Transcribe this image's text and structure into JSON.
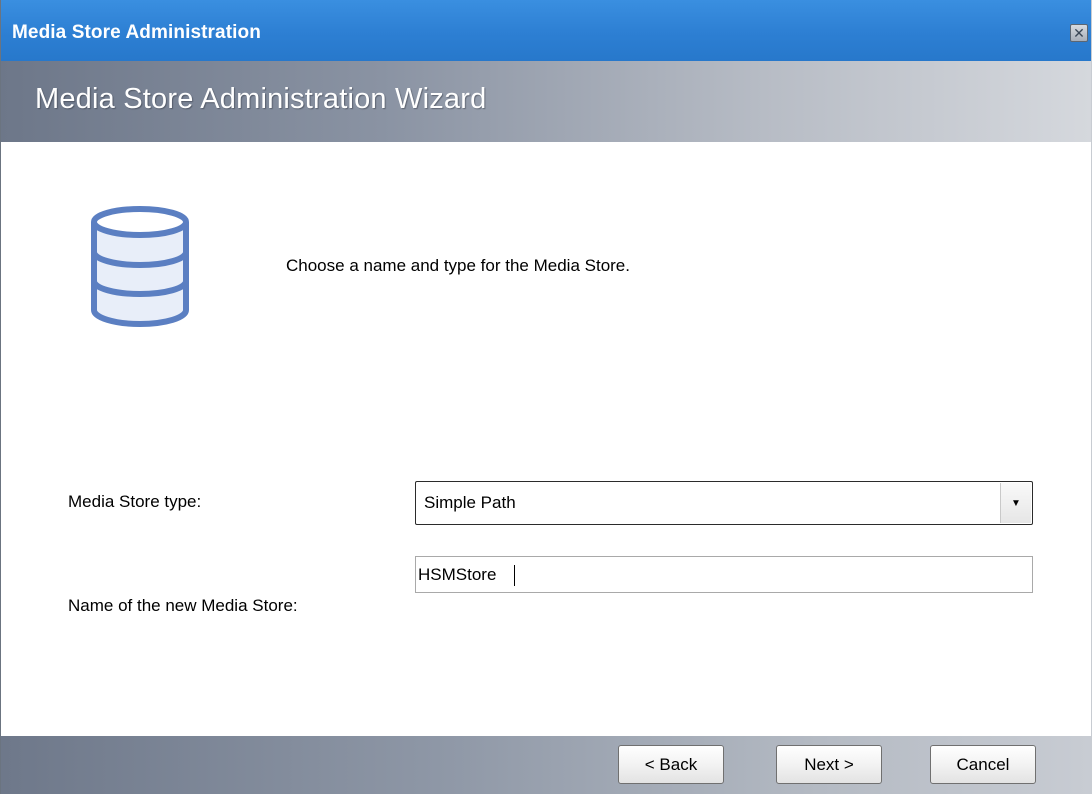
{
  "window": {
    "title": "Media Store Administration",
    "close_icon": "close-icon",
    "close_glyph": "✕"
  },
  "banner": {
    "title": "Media Store Administration Wizard"
  },
  "main": {
    "icon": "database-icon",
    "prompt": "Choose a name and type for the Media Store.",
    "store_type": {
      "label": "Media Store type:",
      "value": "Simple Path",
      "arrow_glyph": "▼"
    },
    "store_name": {
      "label": "Name of the new Media Store:",
      "value": "HSMStore"
    }
  },
  "footer": {
    "back_label": "< Back",
    "next_label": "Next >",
    "cancel_label": "Cancel"
  },
  "colors": {
    "titlebar": "#2d7fd3",
    "icon_stroke": "#5b7fc2",
    "icon_fill": "#e6edf8"
  }
}
